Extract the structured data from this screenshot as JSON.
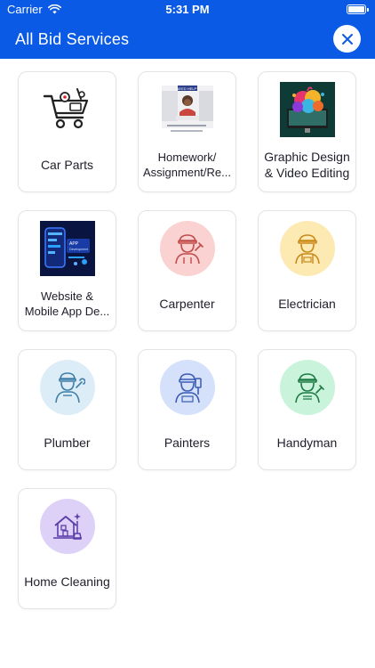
{
  "status": {
    "carrier": "Carrier",
    "time": "5:31 PM"
  },
  "header": {
    "title": "All Bid Services"
  },
  "colors": {
    "primary": "#0a5ae6"
  },
  "services": [
    {
      "label": "Car Parts",
      "icon": "shopping-cart-parts-icon"
    },
    {
      "label": "Homework/ Assignment/Re...",
      "icon": "homework-image"
    },
    {
      "label": "Graphic Design & Video Editing",
      "icon": "graphic-design-image"
    },
    {
      "label": "Website & Mobile App De...",
      "icon": "app-development-image"
    },
    {
      "label": "Carpenter",
      "icon": "carpenter-icon"
    },
    {
      "label": "Electrician",
      "icon": "electrician-icon"
    },
    {
      "label": "Plumber",
      "icon": "plumber-icon"
    },
    {
      "label": "Painters",
      "icon": "painter-icon"
    },
    {
      "label": "Handyman",
      "icon": "handyman-icon"
    },
    {
      "label": "Home Cleaning",
      "icon": "home-cleaning-icon"
    }
  ],
  "images": {
    "homework_sign": "NEED HELP?"
  }
}
